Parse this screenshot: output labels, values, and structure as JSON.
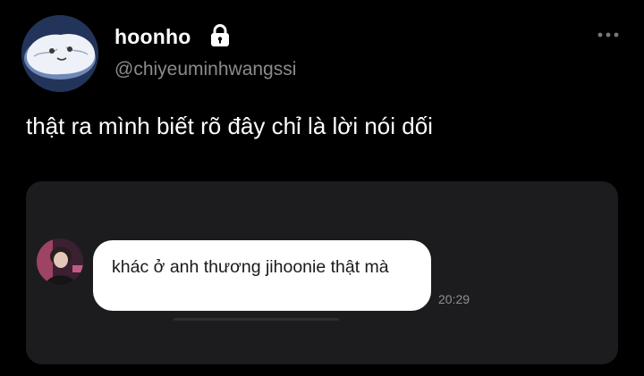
{
  "profile": {
    "display_name": "hoonho",
    "handle": "@chiyeuminhwangssi",
    "lock_icon": "lock-icon"
  },
  "tweet": {
    "text": "thật ra mình biết rõ đây chỉ là lời nói dối"
  },
  "media": {
    "message_text": "khác ở anh thương jihoonie thật mà",
    "time": "20:29"
  },
  "icons": {
    "more": "more-horizontal-icon"
  },
  "colors": {
    "background": "#000000",
    "secondary_text": "#8b8b8b",
    "media_background": "#1c1c1e",
    "bubble": "#ffffff"
  }
}
